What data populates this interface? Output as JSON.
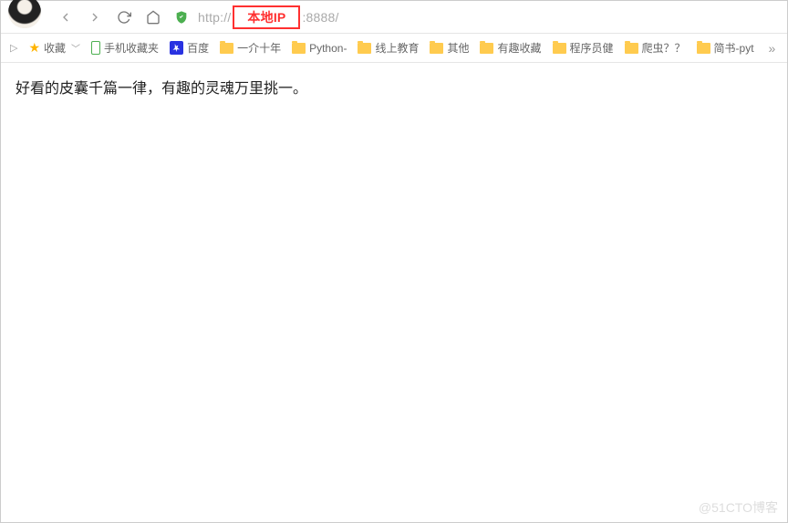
{
  "address": {
    "prefix": "http://",
    "highlight": "本地IP",
    "suffix": ":8888/"
  },
  "bookmarks": {
    "fav_label": "收藏",
    "phone_label": "手机收藏夹",
    "baidu_label": "百度",
    "items": [
      {
        "label": "一介十年"
      },
      {
        "label": "Python-"
      },
      {
        "label": "线上教育"
      },
      {
        "label": "其他"
      },
      {
        "label": "有趣收藏"
      },
      {
        "label": "程序员健"
      },
      {
        "label": "爬虫？？"
      },
      {
        "label": "简书-pyt"
      }
    ]
  },
  "page": {
    "body_text": "好看的皮囊千篇一律，有趣的灵魂万里挑一。"
  },
  "watermark": "@51CTO博客"
}
